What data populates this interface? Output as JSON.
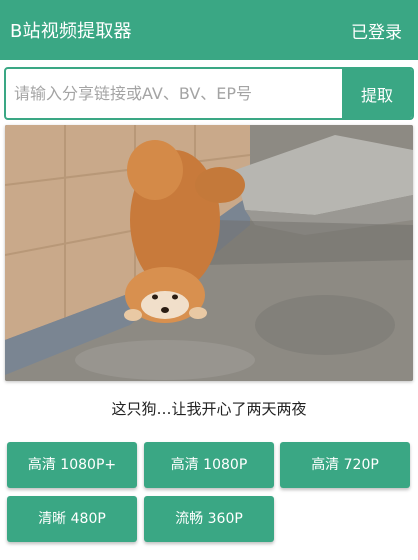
{
  "appbar": {
    "title": "B站视频提取器",
    "login_label": "已登录"
  },
  "search": {
    "placeholder": "请输入分享链接或AV、BV、EP号",
    "value": "",
    "extract_label": "提取"
  },
  "video": {
    "title": "这只狗…让我开心了两天两夜"
  },
  "qualities": [
    {
      "label": "高清 1080P+"
    },
    {
      "label": "高清 1080P"
    },
    {
      "label": "高清 720P"
    },
    {
      "label": "清晰 480P"
    },
    {
      "label": "流畅 360P"
    }
  ],
  "colors": {
    "accent": "#3aa784",
    "background": "#ffffff",
    "text": "#222222",
    "placeholder": "#a4a4a4"
  }
}
